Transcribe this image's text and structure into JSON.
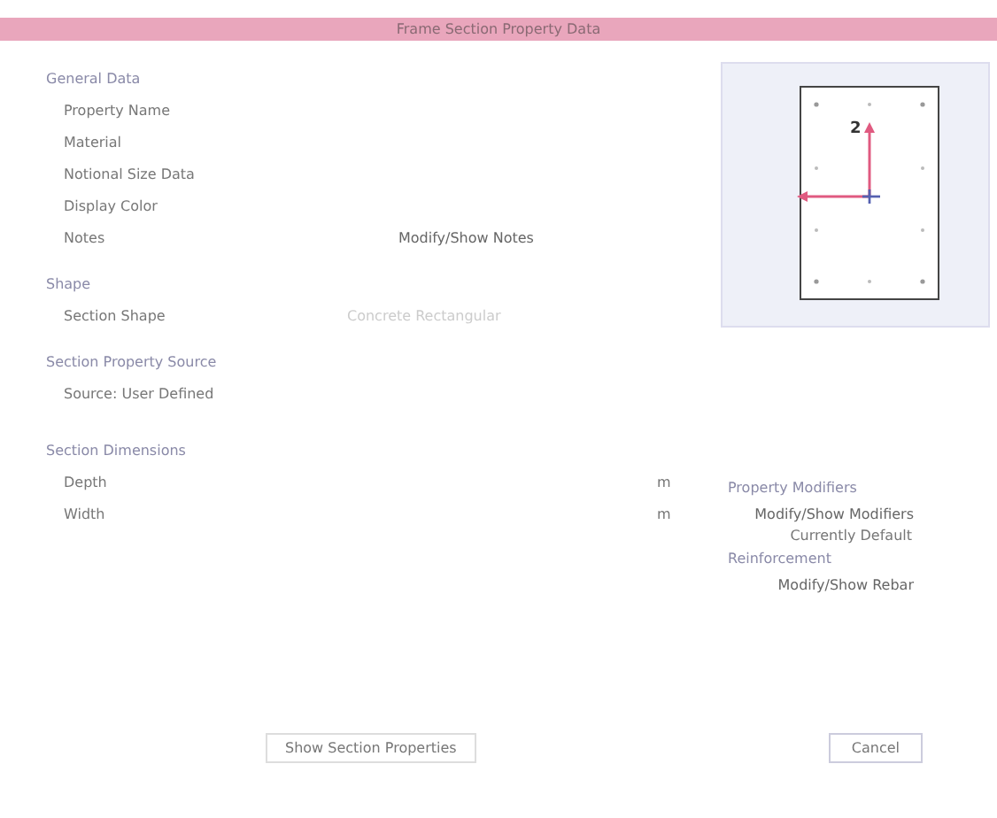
{
  "window": {
    "title": "Frame Section Property Data"
  },
  "general_data": {
    "heading": "General Data",
    "rows": [
      {
        "label": "Property Name"
      },
      {
        "label": "Material"
      },
      {
        "label": "Notional Size Data"
      },
      {
        "label": "Display Color"
      },
      {
        "label": "Notes",
        "button": "Modify/Show Notes"
      }
    ]
  },
  "shape": {
    "heading": "Shape",
    "rows": [
      {
        "label": "Section Shape",
        "value": "Concrete Rectangular",
        "disabled": true
      }
    ]
  },
  "section_property_source": {
    "heading": "Section Property Source",
    "source": "Source:  User Defined"
  },
  "section_dimensions": {
    "heading": "Section Dimensions",
    "rows": [
      {
        "label": "Depth",
        "unit": "m"
      },
      {
        "label": "Width",
        "unit": "m"
      }
    ]
  },
  "preview": {
    "axis_label": "2"
  },
  "property_modifiers": {
    "heading": "Property Modifiers",
    "button": "Modify/Show Modifiers",
    "status": "Currently Default"
  },
  "reinforcement": {
    "heading": "Reinforcement",
    "button": "Modify/Show Rebar"
  },
  "buttons": {
    "show_properties": "Show Section Properties",
    "cancel": "Cancel"
  }
}
